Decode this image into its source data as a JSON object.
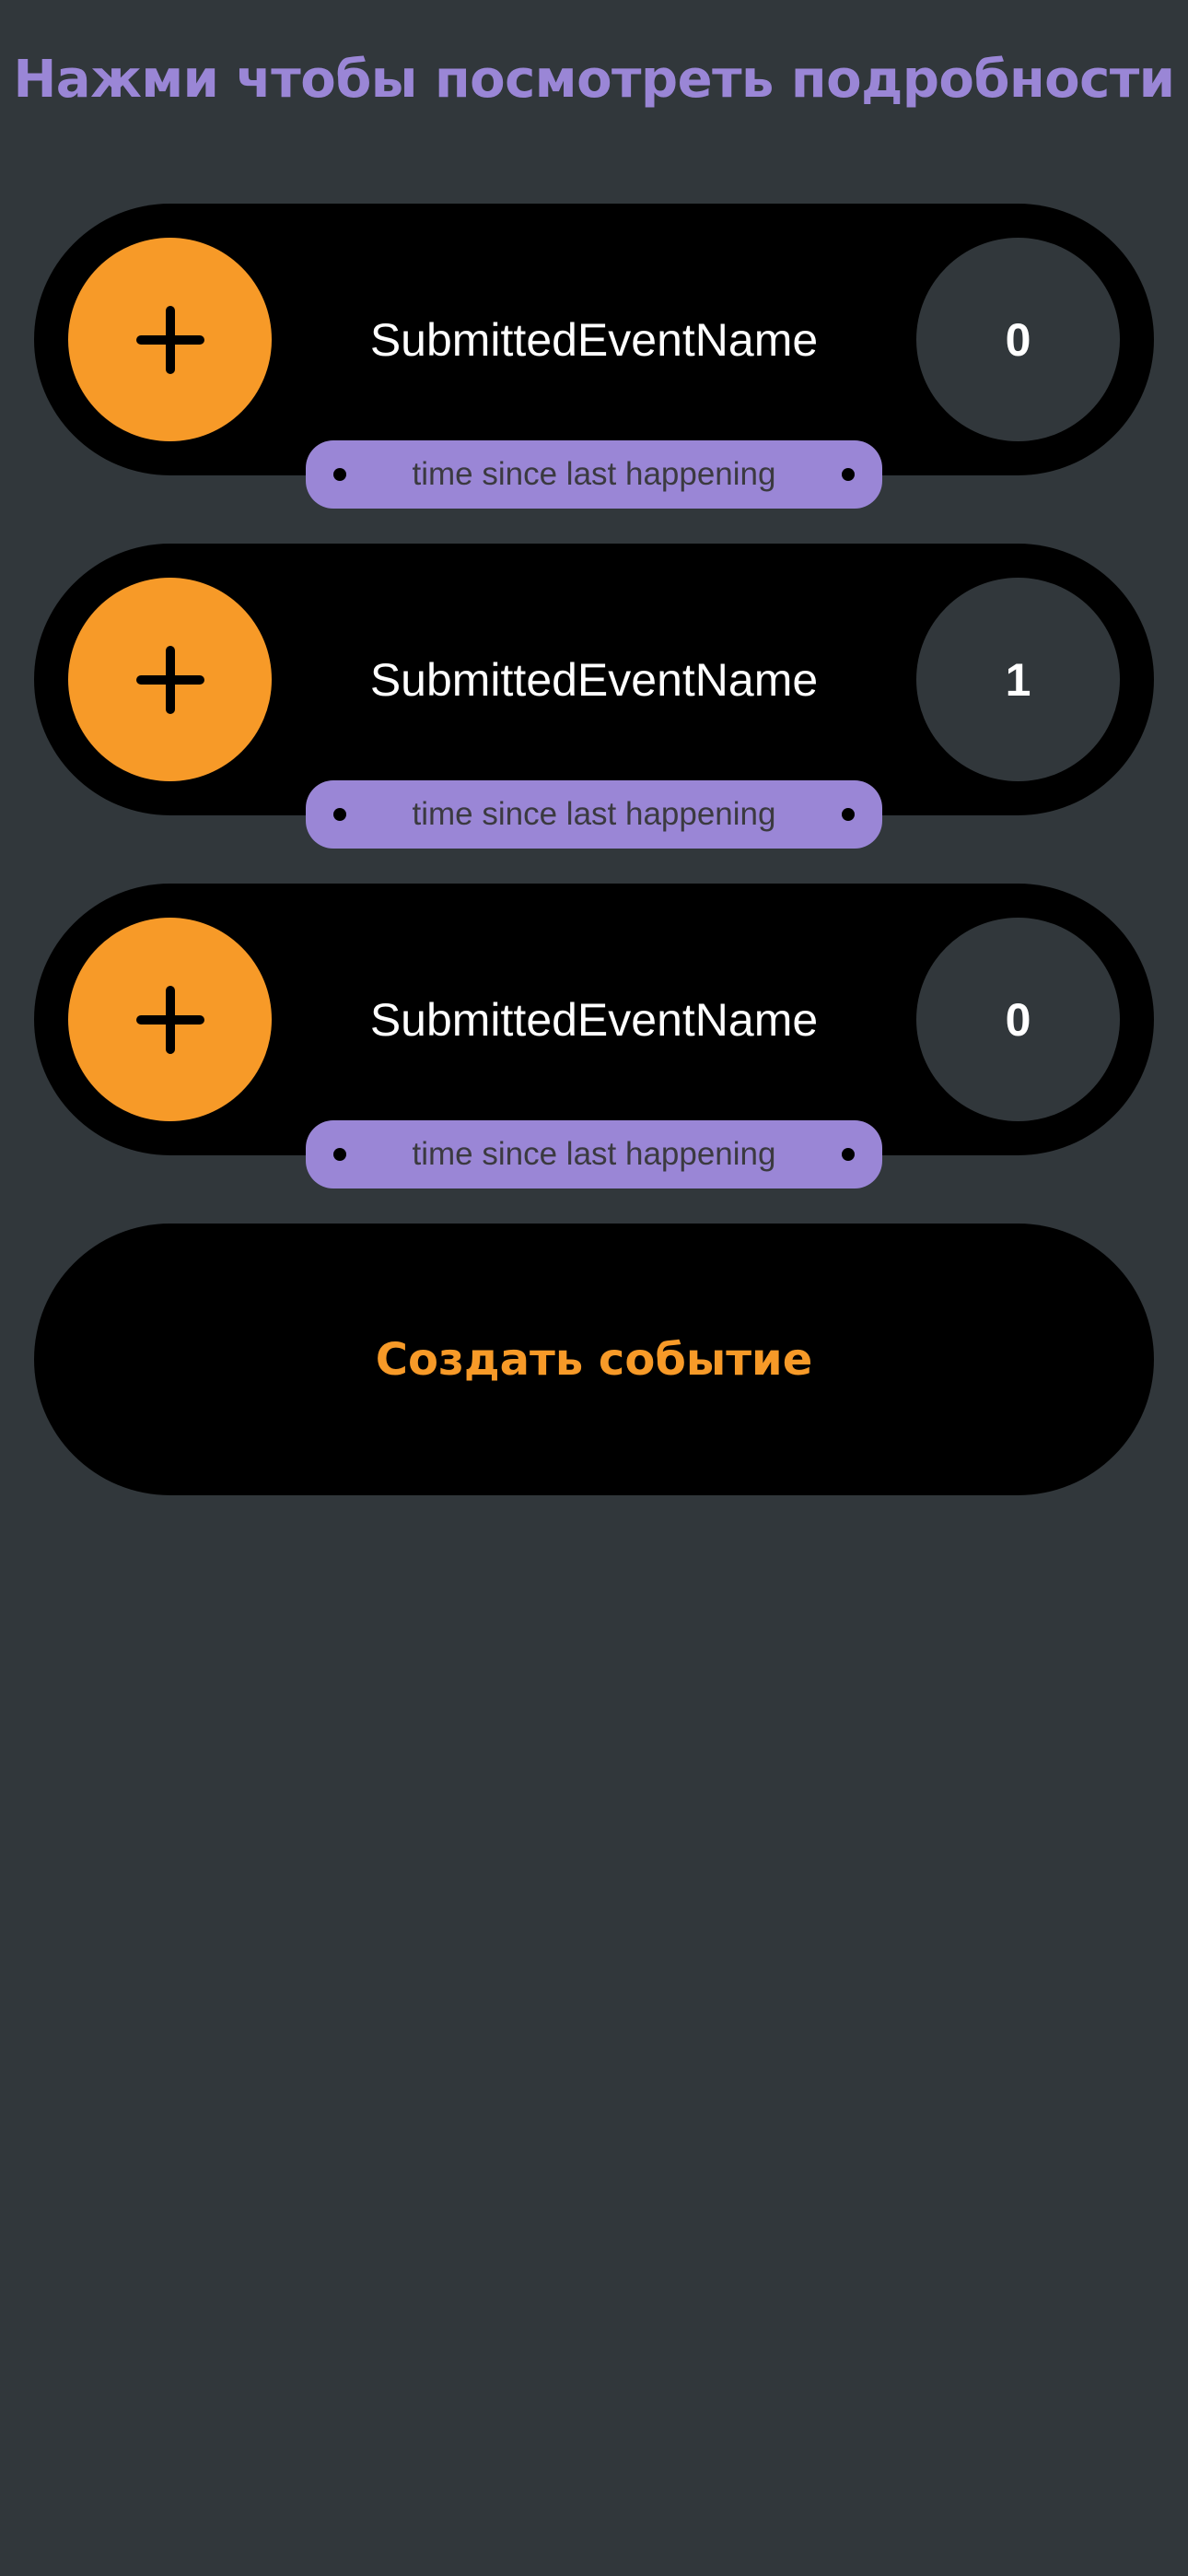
{
  "header": {
    "title": "Нажми чтобы посмотреть подробности"
  },
  "events": [
    {
      "name": "SubmittedEventName",
      "count": "0",
      "time_label": "time since last happening",
      "increment_icon": "plus-icon"
    },
    {
      "name": "SubmittedEventName",
      "count": "1",
      "time_label": "time since last happening",
      "increment_icon": "plus-icon"
    },
    {
      "name": "SubmittedEventName",
      "count": "0",
      "time_label": "time since last happening",
      "increment_icon": "plus-icon"
    }
  ],
  "create_button": {
    "label": "Создать событие"
  },
  "colors": {
    "background": "#31373b",
    "accent_orange": "#f79a28",
    "accent_purple": "#9a86d6",
    "pill": "#000000"
  }
}
